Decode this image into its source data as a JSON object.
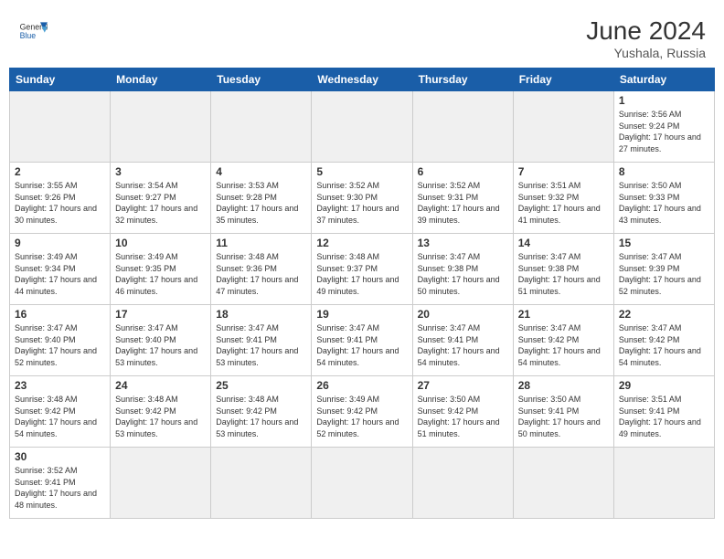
{
  "header": {
    "logo_general": "General",
    "logo_blue": "Blue",
    "month_year": "June 2024",
    "location": "Yushala, Russia"
  },
  "days_of_week": [
    "Sunday",
    "Monday",
    "Tuesday",
    "Wednesday",
    "Thursday",
    "Friday",
    "Saturday"
  ],
  "weeks": [
    {
      "days": [
        {
          "number": "",
          "empty": true
        },
        {
          "number": "",
          "empty": true
        },
        {
          "number": "",
          "empty": true
        },
        {
          "number": "",
          "empty": true
        },
        {
          "number": "",
          "empty": true
        },
        {
          "number": "",
          "empty": true
        },
        {
          "number": "1",
          "sunrise": "3:56 AM",
          "sunset": "9:24 PM",
          "daylight": "17 hours and 27 minutes."
        }
      ]
    },
    {
      "days": [
        {
          "number": "2",
          "sunrise": "3:55 AM",
          "sunset": "9:26 PM",
          "daylight": "17 hours and 30 minutes."
        },
        {
          "number": "3",
          "sunrise": "3:54 AM",
          "sunset": "9:27 PM",
          "daylight": "17 hours and 32 minutes."
        },
        {
          "number": "4",
          "sunrise": "3:53 AM",
          "sunset": "9:28 PM",
          "daylight": "17 hours and 35 minutes."
        },
        {
          "number": "5",
          "sunrise": "3:52 AM",
          "sunset": "9:30 PM",
          "daylight": "17 hours and 37 minutes."
        },
        {
          "number": "6",
          "sunrise": "3:52 AM",
          "sunset": "9:31 PM",
          "daylight": "17 hours and 39 minutes."
        },
        {
          "number": "7",
          "sunrise": "3:51 AM",
          "sunset": "9:32 PM",
          "daylight": "17 hours and 41 minutes."
        },
        {
          "number": "8",
          "sunrise": "3:50 AM",
          "sunset": "9:33 PM",
          "daylight": "17 hours and 43 minutes."
        }
      ]
    },
    {
      "days": [
        {
          "number": "9",
          "sunrise": "3:49 AM",
          "sunset": "9:34 PM",
          "daylight": "17 hours and 44 minutes."
        },
        {
          "number": "10",
          "sunrise": "3:49 AM",
          "sunset": "9:35 PM",
          "daylight": "17 hours and 46 minutes."
        },
        {
          "number": "11",
          "sunrise": "3:48 AM",
          "sunset": "9:36 PM",
          "daylight": "17 hours and 47 minutes."
        },
        {
          "number": "12",
          "sunrise": "3:48 AM",
          "sunset": "9:37 PM",
          "daylight": "17 hours and 49 minutes."
        },
        {
          "number": "13",
          "sunrise": "3:47 AM",
          "sunset": "9:38 PM",
          "daylight": "17 hours and 50 minutes."
        },
        {
          "number": "14",
          "sunrise": "3:47 AM",
          "sunset": "9:38 PM",
          "daylight": "17 hours and 51 minutes."
        },
        {
          "number": "15",
          "sunrise": "3:47 AM",
          "sunset": "9:39 PM",
          "daylight": "17 hours and 52 minutes."
        }
      ]
    },
    {
      "days": [
        {
          "number": "16",
          "sunrise": "3:47 AM",
          "sunset": "9:40 PM",
          "daylight": "17 hours and 52 minutes."
        },
        {
          "number": "17",
          "sunrise": "3:47 AM",
          "sunset": "9:40 PM",
          "daylight": "17 hours and 53 minutes."
        },
        {
          "number": "18",
          "sunrise": "3:47 AM",
          "sunset": "9:41 PM",
          "daylight": "17 hours and 53 minutes."
        },
        {
          "number": "19",
          "sunrise": "3:47 AM",
          "sunset": "9:41 PM",
          "daylight": "17 hours and 54 minutes."
        },
        {
          "number": "20",
          "sunrise": "3:47 AM",
          "sunset": "9:41 PM",
          "daylight": "17 hours and 54 minutes."
        },
        {
          "number": "21",
          "sunrise": "3:47 AM",
          "sunset": "9:42 PM",
          "daylight": "17 hours and 54 minutes."
        },
        {
          "number": "22",
          "sunrise": "3:47 AM",
          "sunset": "9:42 PM",
          "daylight": "17 hours and 54 minutes."
        }
      ]
    },
    {
      "days": [
        {
          "number": "23",
          "sunrise": "3:48 AM",
          "sunset": "9:42 PM",
          "daylight": "17 hours and 54 minutes."
        },
        {
          "number": "24",
          "sunrise": "3:48 AM",
          "sunset": "9:42 PM",
          "daylight": "17 hours and 53 minutes."
        },
        {
          "number": "25",
          "sunrise": "3:48 AM",
          "sunset": "9:42 PM",
          "daylight": "17 hours and 53 minutes."
        },
        {
          "number": "26",
          "sunrise": "3:49 AM",
          "sunset": "9:42 PM",
          "daylight": "17 hours and 52 minutes."
        },
        {
          "number": "27",
          "sunrise": "3:50 AM",
          "sunset": "9:42 PM",
          "daylight": "17 hours and 51 minutes."
        },
        {
          "number": "28",
          "sunrise": "3:50 AM",
          "sunset": "9:41 PM",
          "daylight": "17 hours and 50 minutes."
        },
        {
          "number": "29",
          "sunrise": "3:51 AM",
          "sunset": "9:41 PM",
          "daylight": "17 hours and 49 minutes."
        }
      ]
    },
    {
      "days": [
        {
          "number": "30",
          "sunrise": "3:52 AM",
          "sunset": "9:41 PM",
          "daylight": "17 hours and 48 minutes."
        },
        {
          "number": "",
          "empty": true
        },
        {
          "number": "",
          "empty": true
        },
        {
          "number": "",
          "empty": true
        },
        {
          "number": "",
          "empty": true
        },
        {
          "number": "",
          "empty": true
        },
        {
          "number": "",
          "empty": true
        }
      ]
    }
  ]
}
